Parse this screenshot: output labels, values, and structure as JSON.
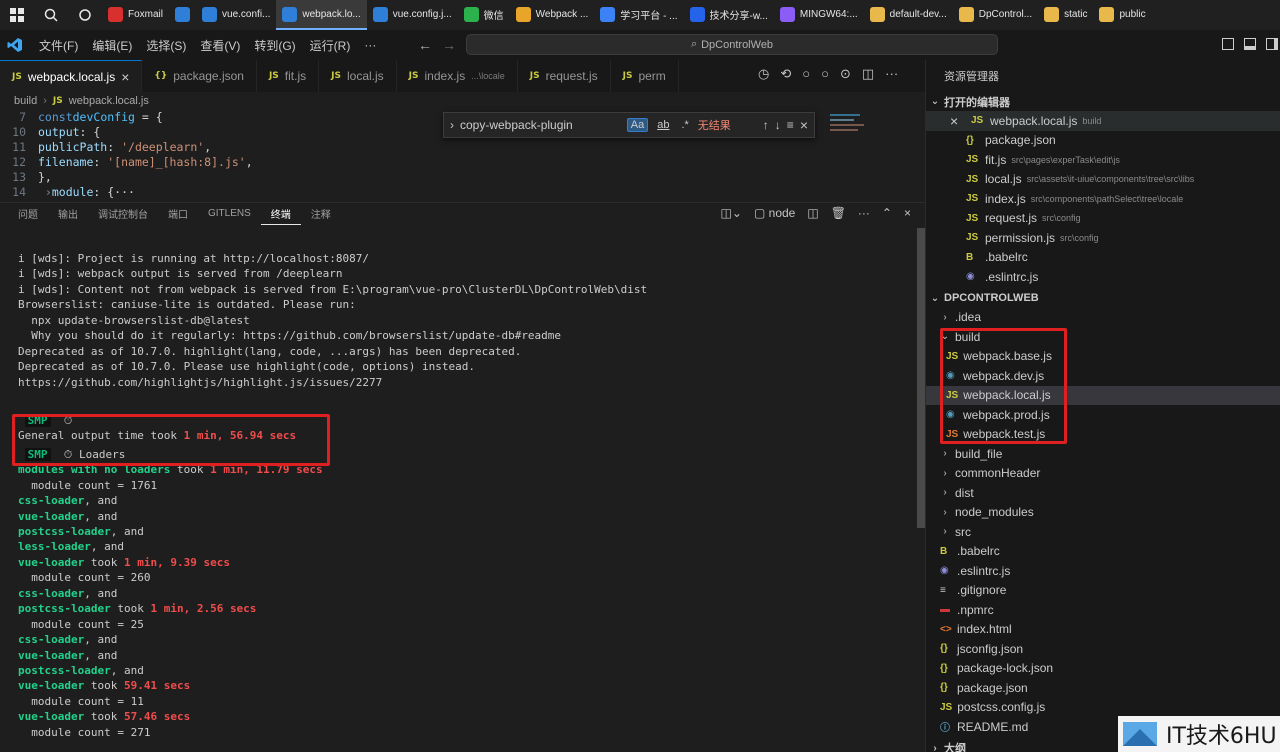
{
  "taskbar": {
    "apps": [
      {
        "label": "Foxmail",
        "color": "#d8302e",
        "active": false
      },
      {
        "label": "",
        "color": "#2f7fd8",
        "active": false
      },
      {
        "label": "vue.confi...",
        "color": "#2f7fd8",
        "active": false
      },
      {
        "label": "webpack.lo...",
        "color": "#2f7fd8",
        "active": true
      },
      {
        "label": "vue.config.j...",
        "color": "#2f7fd8",
        "active": false
      },
      {
        "label": "微信",
        "color": "#2bb24c",
        "active": false
      },
      {
        "label": "Webpack ...",
        "color": "#e9a52a",
        "active": false
      },
      {
        "label": "学习平台 - ...",
        "color": "#3b82f6",
        "active": false
      },
      {
        "label": "技术分享-w...",
        "color": "#2563eb",
        "active": false
      },
      {
        "label": "MINGW64:...",
        "color": "#8b5cf6",
        "active": false
      },
      {
        "label": "default-dev...",
        "color": "#e8b84a",
        "active": false
      },
      {
        "label": "DpControl...",
        "color": "#e8b84a",
        "active": false
      },
      {
        "label": "static",
        "color": "#e8b84a",
        "active": false
      },
      {
        "label": "public",
        "color": "#e8b84a",
        "active": false
      }
    ]
  },
  "titlebar": {
    "menus": [
      "文件(F)",
      "编辑(E)",
      "选择(S)",
      "查看(V)",
      "转到(G)",
      "运行(R)",
      "···"
    ],
    "command_center": "DpControlWeb"
  },
  "tabs": [
    {
      "label": "webpack.local.js",
      "prefix": "JS",
      "active": true,
      "close": "×"
    },
    {
      "label": "package.json",
      "prefix": "{}",
      "active": false
    },
    {
      "label": "fit.js",
      "prefix": "JS",
      "active": false
    },
    {
      "label": "local.js",
      "prefix": "JS",
      "active": false
    },
    {
      "label": "index.js",
      "prefix": "JS",
      "active": false,
      "hint": "...\\locale"
    },
    {
      "label": "request.js",
      "prefix": "JS",
      "active": false
    },
    {
      "label": "perm",
      "prefix": "JS",
      "active": false
    }
  ],
  "breadcrumb": {
    "folder": "build",
    "prefix": "JS",
    "file": "webpack.local.js"
  },
  "code": [
    {
      "n": "7"
    },
    {
      "n": "10"
    },
    {
      "n": "11"
    },
    {
      "n": "12"
    },
    {
      "n": "13"
    },
    {
      "n": "14"
    },
    {
      "n": "15"
    }
  ],
  "code_text": {
    "l7a": "const",
    "l7b": "devConfig",
    "l7c": " = {",
    "l10a": "output",
    "l10b": ": {",
    "l11a": "publicPath",
    "l11b": ": ",
    "l11c": "'/deeplearn'",
    "l11d": ",",
    "l12a": "filename",
    "l12b": ": ",
    "l12c": "'[name]_[hash:8].js'",
    "l12d": ",",
    "l13": "},",
    "l15a": "module",
    "l15b": ": {···"
  },
  "find": {
    "query": "copy-webpack-plugin",
    "opt_case": "Aa",
    "opt_word": "ab",
    "opt_regex": ".*",
    "result": "无结果"
  },
  "panel": {
    "tabs": [
      "问题",
      "输出",
      "调试控制台",
      "端口",
      "GITLENS",
      "终端",
      "注释"
    ],
    "active_tab": "终端",
    "shell": "node"
  },
  "terminal": {
    "wds1": "i [wds]: Project is running at http://localhost:8087/",
    "wds2": "i [wds]: webpack output is served from /deeplearn",
    "wds3": "i [wds]: Content not from webpack is served from E:\\program\\vue-pro\\ClusterDL\\DpControlWeb\\dist",
    "bl1": "Browserslist: caniuse-lite is outdated. Please run:",
    "bl2": "  npx update-browserslist-db@latest",
    "bl3": "  Why you should do it regularly: https://github.com/browserslist/update-db#readme",
    "dep1": "Deprecated as of 10.7.0. highlight(lang, code, ...args) has been deprecated.",
    "dep2": "Deprecated as of 10.7.0. Please use highlight(code, options) instead.",
    "dep3": "https://github.com/highlightjs/highlight.js/issues/2277",
    "smp": "SMP",
    "smp_icon": "⏱",
    "general": "General output time took ",
    "general_time": "1 min, 56.94 secs",
    "loaders": "Loaders",
    "rows": [
      {
        "a": "modules with no loaders",
        "b": " took ",
        "c": "1 min, 11.79 secs"
      },
      {
        "a": "",
        "b": "  module count = 1761",
        "c": ""
      },
      {
        "a": "css-loader",
        "b": ", and",
        "c": ""
      },
      {
        "a": "vue-loader",
        "b": ", and",
        "c": ""
      },
      {
        "a": "postcss-loader",
        "b": ", and",
        "c": ""
      },
      {
        "a": "less-loader",
        "b": ", and",
        "c": ""
      },
      {
        "a": "vue-loader",
        "b": " took ",
        "c": "1 min, 9.39 secs"
      },
      {
        "a": "",
        "b": "  module count = 260",
        "c": ""
      },
      {
        "a": "css-loader",
        "b": ", and",
        "c": ""
      },
      {
        "a": "postcss-loader",
        "b": " took ",
        "c": "1 min, 2.56 secs"
      },
      {
        "a": "",
        "b": "  module count = 25",
        "c": ""
      },
      {
        "a": "css-loader",
        "b": ", and",
        "c": ""
      },
      {
        "a": "vue-loader",
        "b": ", and",
        "c": ""
      },
      {
        "a": "postcss-loader",
        "b": ", and",
        "c": ""
      },
      {
        "a": "vue-loader",
        "b": " took ",
        "c": "59.41 secs"
      },
      {
        "a": "",
        "b": "  module count = 11",
        "c": ""
      },
      {
        "a": "vue-loader",
        "b": " took ",
        "c": "57.46 secs"
      },
      {
        "a": "",
        "b": "  module count = 271",
        "c": ""
      }
    ]
  },
  "explorer": {
    "title": "资源管理器",
    "open_editors_title": "打开的编辑器",
    "open_editors": [
      {
        "name": "webpack.local.js",
        "path": "build",
        "icon": "JS",
        "color": "#cbcb41",
        "close": "×"
      },
      {
        "name": "package.json",
        "path": "",
        "icon": "{}",
        "color": "#cbcb41"
      },
      {
        "name": "fit.js",
        "path": "src\\pages\\experTask\\edit\\js",
        "icon": "JS",
        "color": "#cbcb41"
      },
      {
        "name": "local.js",
        "path": "src\\assets\\it-uiue\\components\\tree\\src\\libs",
        "icon": "JS",
        "color": "#cbcb41"
      },
      {
        "name": "index.js",
        "path": "src\\components\\pathSelect\\tree\\locale",
        "icon": "JS",
        "color": "#cbcb41"
      },
      {
        "name": "request.js",
        "path": "src\\config",
        "icon": "JS",
        "color": "#cbcb41"
      },
      {
        "name": "permission.js",
        "path": "src\\config",
        "icon": "JS",
        "color": "#cbcb41"
      },
      {
        "name": ".babelrc",
        "path": "",
        "icon": "B",
        "color": "#cbcb41"
      },
      {
        "name": ".eslintrc.js",
        "path": "",
        "icon": "◉",
        "color": "#8b8bd8"
      }
    ],
    "project_title": "DPCONTROLWEB",
    "tree": [
      {
        "name": ".idea",
        "level": 0,
        "twisty": "›",
        "icon": "",
        "color": "#cccccc"
      },
      {
        "name": "build",
        "level": 0,
        "twisty": "⌄",
        "icon": "",
        "color": "#cccccc"
      },
      {
        "name": "webpack.base.js",
        "level": 1,
        "twisty": "",
        "icon": "JS",
        "color": "#cbcb41"
      },
      {
        "name": "webpack.dev.js",
        "level": 1,
        "twisty": "",
        "icon": "◉",
        "color": "#519aba"
      },
      {
        "name": "webpack.local.js",
        "level": 1,
        "twisty": "",
        "icon": "JS",
        "color": "#cbcb41",
        "selected": true
      },
      {
        "name": "webpack.prod.js",
        "level": 1,
        "twisty": "",
        "icon": "◉",
        "color": "#519aba"
      },
      {
        "name": "webpack.test.js",
        "level": 1,
        "twisty": "",
        "icon": "JS",
        "color": "#e37933"
      },
      {
        "name": "build_file",
        "level": 0,
        "twisty": "›",
        "icon": "",
        "color": "#cccccc"
      },
      {
        "name": "commonHeader",
        "level": 0,
        "twisty": "›",
        "icon": "",
        "color": "#cccccc"
      },
      {
        "name": "dist",
        "level": 0,
        "twisty": "›",
        "icon": "",
        "color": "#cccccc"
      },
      {
        "name": "node_modules",
        "level": 0,
        "twisty": "›",
        "icon": "",
        "color": "#cccccc"
      },
      {
        "name": "src",
        "level": 0,
        "twisty": "›",
        "icon": "",
        "color": "#cccccc"
      },
      {
        "name": ".babelrc",
        "level": 0,
        "twisty": "",
        "icon": "B",
        "color": "#cbcb41"
      },
      {
        "name": ".eslintrc.js",
        "level": 0,
        "twisty": "",
        "icon": "◉",
        "color": "#8b8bd8"
      },
      {
        "name": ".gitignore",
        "level": 0,
        "twisty": "",
        "icon": "≡",
        "color": "#cccccc"
      },
      {
        "name": ".npmrc",
        "level": 0,
        "twisty": "",
        "icon": "▬",
        "color": "#cb3837"
      },
      {
        "name": "index.html",
        "level": 0,
        "twisty": "",
        "icon": "<>",
        "color": "#e37933"
      },
      {
        "name": "jsconfig.json",
        "level": 0,
        "twisty": "",
        "icon": "{}",
        "color": "#cbcb41"
      },
      {
        "name": "package-lock.json",
        "level": 0,
        "twisty": "",
        "icon": "{}",
        "color": "#cbcb41"
      },
      {
        "name": "package.json",
        "level": 0,
        "twisty": "",
        "icon": "{}",
        "color": "#cbcb41"
      },
      {
        "name": "postcss.config.js",
        "level": 0,
        "twisty": "",
        "icon": "JS",
        "color": "#cbcb41"
      },
      {
        "name": "README.md",
        "level": 0,
        "twisty": "",
        "icon": "ⓘ",
        "color": "#519aba"
      }
    ],
    "outline_title": "大纲"
  },
  "watermark": {
    "text": "IT技术6HU"
  }
}
